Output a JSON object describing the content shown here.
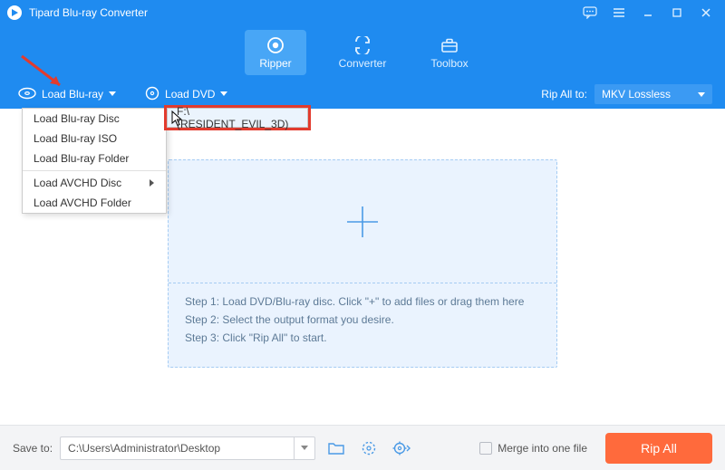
{
  "window": {
    "title": "Tipard Blu-ray Converter"
  },
  "tabs": {
    "ripper": "Ripper",
    "converter": "Converter",
    "toolbox": "Toolbox"
  },
  "loadbar": {
    "bluray_label": "Load Blu-ray",
    "dvd_label": "Load DVD",
    "rip_all_to_label": "Rip All to:",
    "rip_all_to_value": "MKV Lossless"
  },
  "menu": {
    "items": {
      "disc": "Load Blu-ray Disc",
      "iso": "Load Blu-ray ISO",
      "folder": "Load Blu-ray Folder",
      "avchd_disc": "Load AVCHD Disc",
      "avchd_folder": "Load AVCHD Folder"
    }
  },
  "submenu": {
    "item": "F:\\ (RESIDENT_EVIL_3D)"
  },
  "steps": {
    "s1": "Step 1: Load DVD/Blu-ray disc. Click \"+\" to add files or drag them here",
    "s2": "Step 2: Select the output format you desire.",
    "s3": "Step 3: Click \"Rip All\" to start."
  },
  "bottom": {
    "save_to_label": "Save to:",
    "path_value": "C:\\Users\\Administrator\\Desktop",
    "merge_label": "Merge into one file",
    "rip_all_label": "Rip All"
  }
}
